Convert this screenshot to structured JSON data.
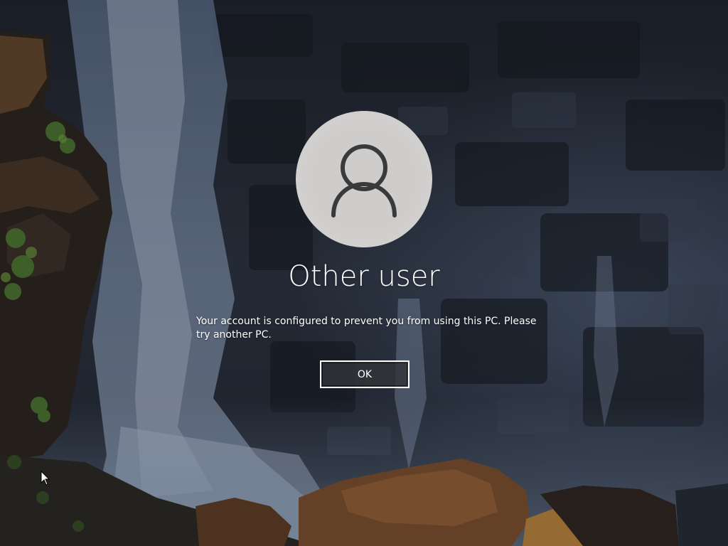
{
  "lock_screen": {
    "background": "waterfall-rock-cliff-wallpaper",
    "accent_color": "#ffffff"
  },
  "user": {
    "avatar_icon": "person-icon",
    "name": "Other user"
  },
  "dialog": {
    "message": "Your account is configured to prevent you from using this PC. Please try another PC.",
    "ok_label": "OK"
  },
  "pointer": {
    "icon": "mouse-pointer-icon"
  }
}
